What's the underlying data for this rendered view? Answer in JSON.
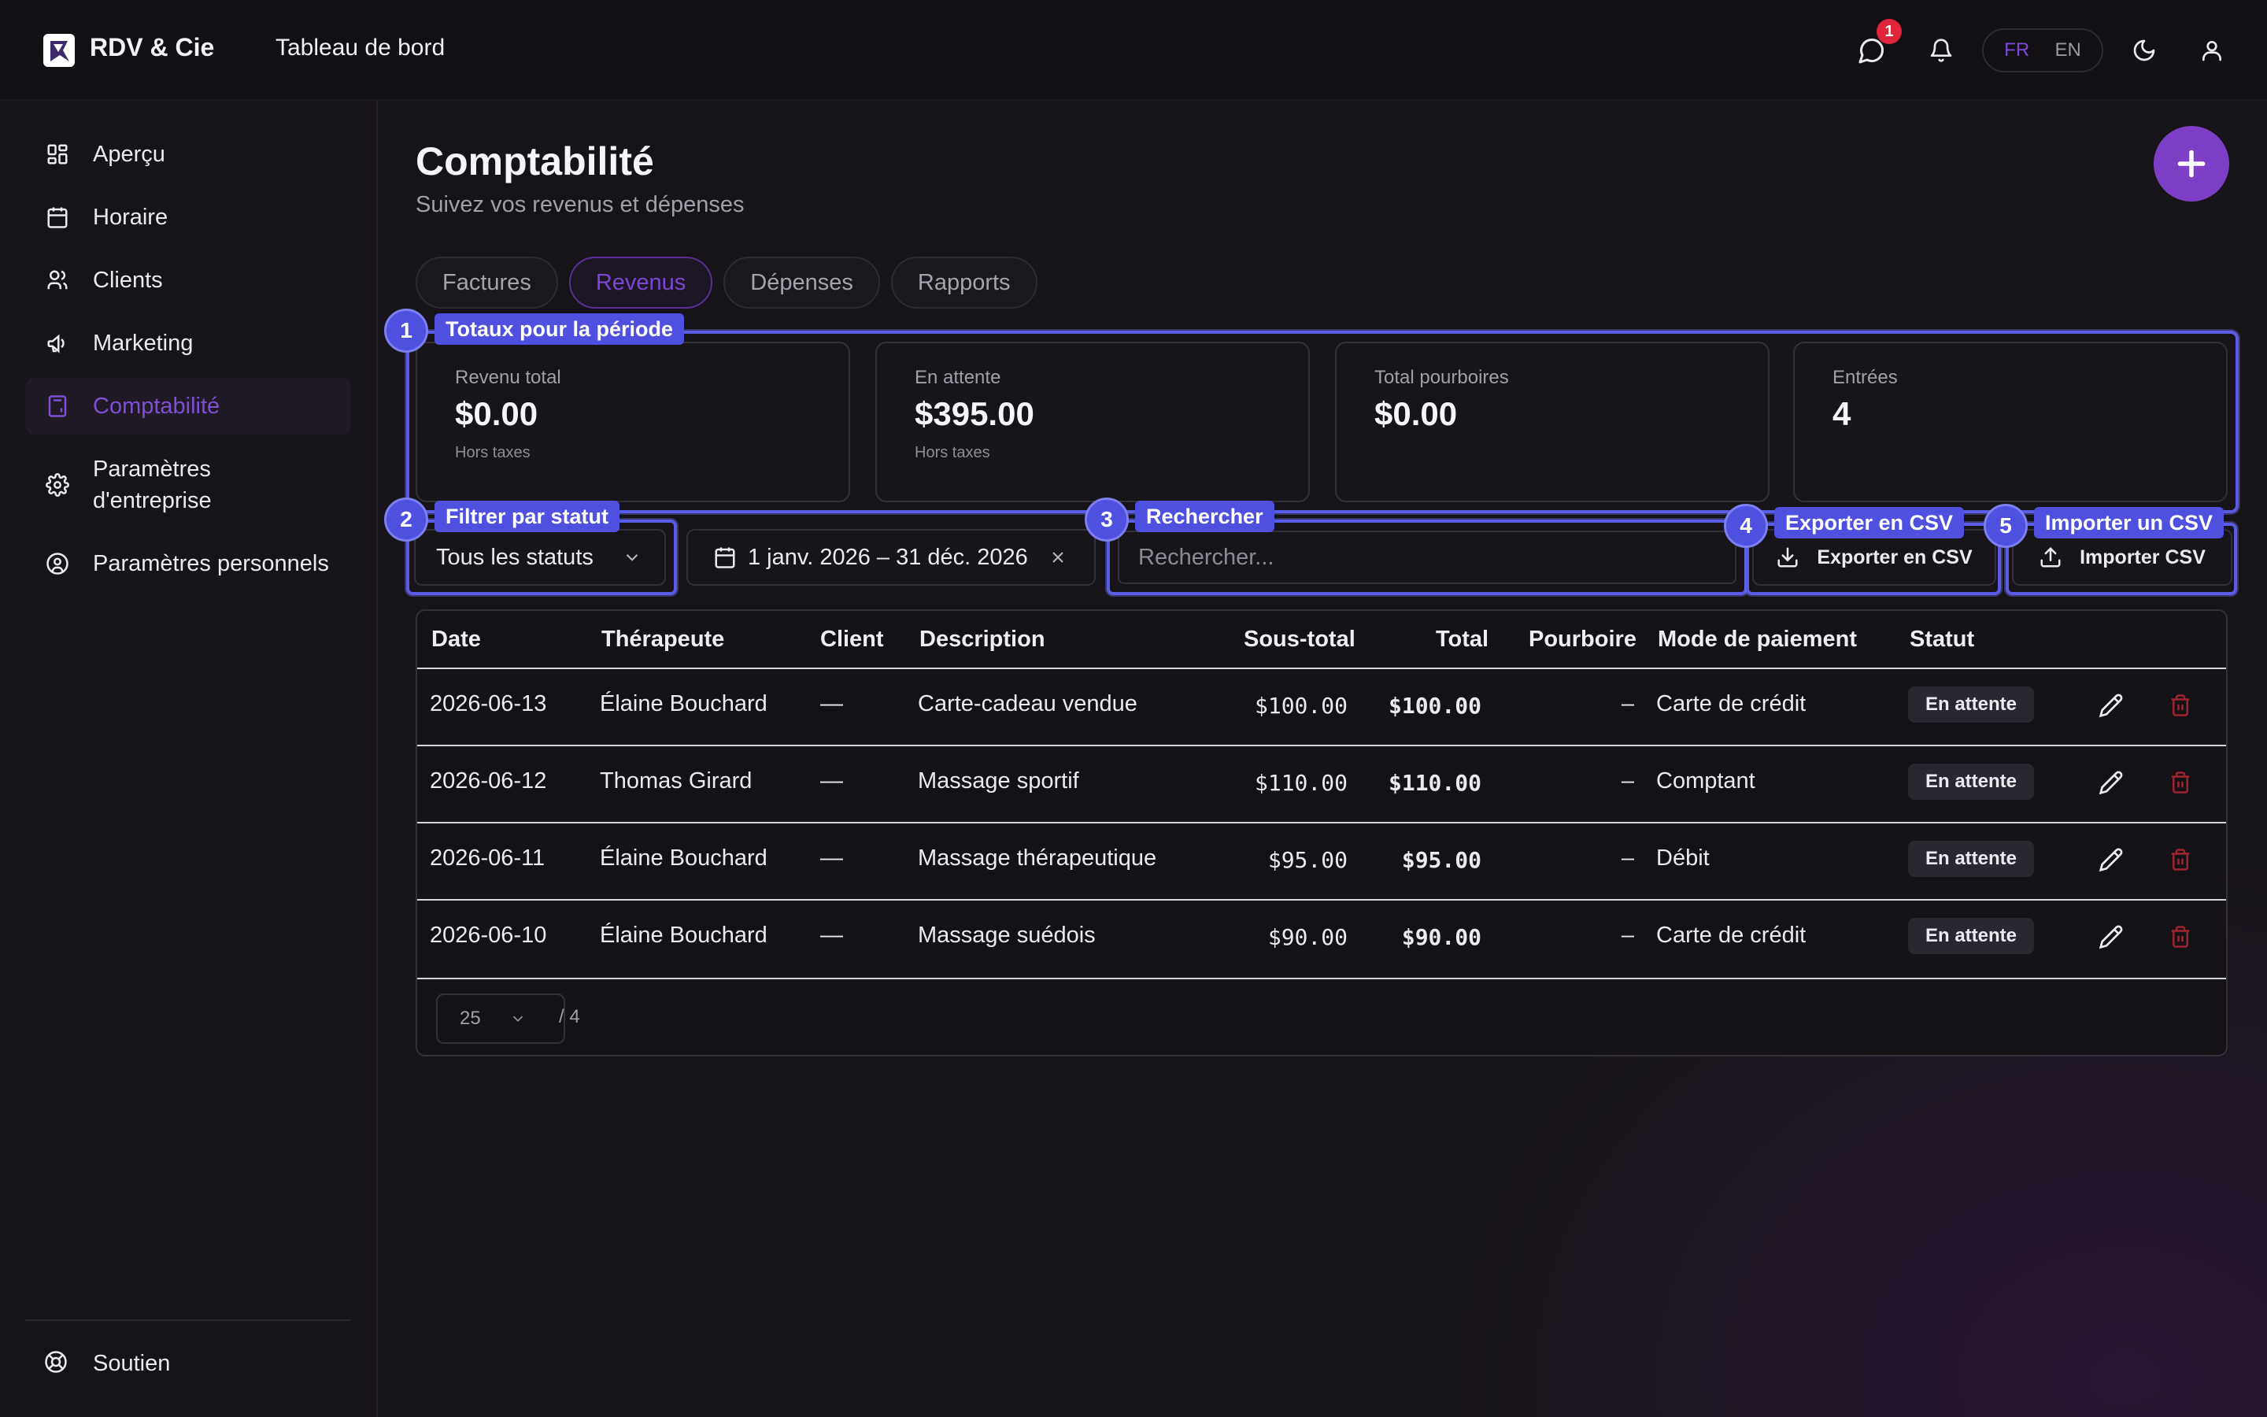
{
  "app": {
    "brand": "RDV & Cie",
    "header_title": "Tableau de bord",
    "notifications_count": "1",
    "languages": [
      "FR",
      "EN"
    ],
    "active_language": "FR"
  },
  "sidebar": {
    "items": [
      {
        "label": "Aperçu",
        "icon": "grid-icon"
      },
      {
        "label": "Horaire",
        "icon": "calendar-icon"
      },
      {
        "label": "Clients",
        "icon": "users-icon"
      },
      {
        "label": "Marketing",
        "icon": "megaphone-icon"
      },
      {
        "label": "Comptabilité",
        "icon": "calculator-icon",
        "active": true
      },
      {
        "label": "Paramètres d'entreprise",
        "line1": "Paramètres",
        "line2": "d'entreprise",
        "icon": "gear-icon"
      },
      {
        "label": "Paramètres personnels",
        "icon": "user-circle-icon"
      }
    ],
    "support_label": "Soutien"
  },
  "page": {
    "title": "Comptabilité",
    "subtitle": "Suivez vos revenus et dépenses"
  },
  "tabs": [
    {
      "label": "Factures"
    },
    {
      "label": "Revenus",
      "active": true
    },
    {
      "label": "Dépenses"
    },
    {
      "label": "Rapports"
    }
  ],
  "stats": [
    {
      "label": "Revenu total",
      "value": "$0.00",
      "note": "Hors taxes"
    },
    {
      "label": "En attente",
      "value": "$395.00",
      "note": "Hors taxes"
    },
    {
      "label": "Total pourboires",
      "value": "$0.00",
      "note": ""
    },
    {
      "label": "Entrées",
      "value": "4",
      "note": ""
    }
  ],
  "callouts": [
    {
      "num": "1",
      "label": "Totaux pour la période"
    },
    {
      "num": "2",
      "label": "Filtrer par statut"
    },
    {
      "num": "3",
      "label": "Rechercher"
    },
    {
      "num": "4",
      "label": "Exporter en CSV"
    },
    {
      "num": "5",
      "label": "Importer un CSV"
    }
  ],
  "filters": {
    "status_value": "Tous les statuts",
    "date_range": "1 janv. 2026 – 31 déc. 2026",
    "search_placeholder": "Rechercher...",
    "export_label": "Exporter en CSV",
    "import_label": "Importer CSV"
  },
  "table": {
    "columns": [
      "Date",
      "Thérapeute",
      "Client",
      "Description",
      "Sous-total",
      "Total",
      "Pourboire",
      "Mode de paiement",
      "Statut"
    ],
    "rows": [
      {
        "date": "2026-06-13",
        "therapist": "Élaine Bouchard",
        "client": "—",
        "description": "Carte-cadeau vendue",
        "subtotal": "$100.00",
        "total": "$100.00",
        "tip": "–",
        "payment": "Carte de crédit",
        "status": "En attente"
      },
      {
        "date": "2026-06-12",
        "therapist": "Thomas Girard",
        "client": "—",
        "description": "Massage sportif",
        "subtotal": "$110.00",
        "total": "$110.00",
        "tip": "–",
        "payment": "Comptant",
        "status": "En attente"
      },
      {
        "date": "2026-06-11",
        "therapist": "Élaine Bouchard",
        "client": "—",
        "description": "Massage thérapeutique",
        "subtotal": "$95.00",
        "total": "$95.00",
        "tip": "–",
        "payment": "Débit",
        "status": "En attente"
      },
      {
        "date": "2026-06-10",
        "therapist": "Élaine Bouchard",
        "client": "—",
        "description": "Massage suédois",
        "subtotal": "$90.00",
        "total": "$90.00",
        "tip": "–",
        "payment": "Carte de crédit",
        "status": "En attente"
      }
    ],
    "page_size": "25",
    "total_label": "/ 4"
  },
  "colors": {
    "accent": "#7c3fc6",
    "callout": "#4f4fe0",
    "danger": "#b3262f",
    "background": "#161418"
  }
}
